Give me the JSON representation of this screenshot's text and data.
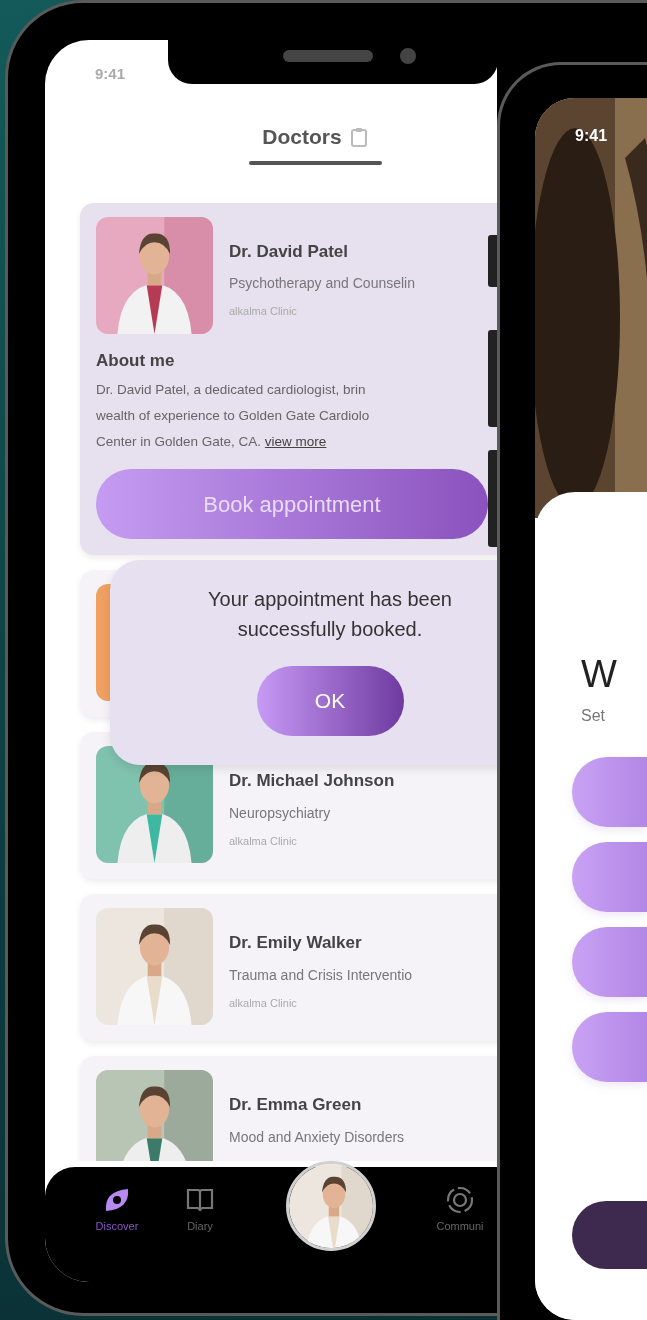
{
  "left_phone": {
    "status_time": "9:41",
    "title": "Doctors",
    "doctors": [
      {
        "name": "Dr. David Patel",
        "specialty": "Psychotherapy and Counselin",
        "clinic": "alkalma Clinic",
        "expanded": true,
        "about_heading": "About me",
        "about_lines": [
          "Dr. David Patel, a dedicated cardiologist, brin",
          "wealth of experience to Golden Gate Cardiolo",
          "Center in Golden Gate, CA."
        ],
        "about_link": "view more",
        "action": "Book appointment",
        "photo": {
          "kind": "picture"
        }
      },
      {
        "expanded": false,
        "photo": {
          "kind": "picture"
        }
      },
      {
        "name": "Dr. Michael Johnson",
        "specialty": "Neuropsychiatry",
        "clinic": "alkalma Clinic",
        "expanded": false,
        "photo": {
          "kind": "picture"
        }
      },
      {
        "name": "Dr. Emily Walker",
        "specialty": "Trauma and Crisis Interventio",
        "clinic": "alkalma Clinic",
        "expanded": false,
        "photo": {
          "kind": "picture"
        }
      },
      {
        "name": "Dr. Emma Green",
        "specialty": "Mood and Anxiety Disorders",
        "expanded": false,
        "photo": {
          "kind": "picture"
        }
      }
    ],
    "dialog": {
      "message": "Your appointment has been successfully booked.",
      "button": "OK"
    },
    "nav": [
      {
        "kind": "tab",
        "label": "Discover",
        "selected": true
      },
      {
        "kind": "tab",
        "label": "Diary",
        "selected": false
      },
      {
        "kind": "avatar"
      },
      {
        "kind": "tab",
        "label": "Communi",
        "selected": false
      }
    ]
  },
  "right_phone": {
    "status_time": "9:41",
    "photo": {
      "kind": "picture"
    },
    "heading": "W",
    "subtitle": "Set",
    "buttons": [
      {
        "kind": "option"
      },
      {
        "kind": "option"
      },
      {
        "kind": "option"
      },
      {
        "kind": "option"
      },
      {
        "kind": "primary"
      }
    ]
  }
}
